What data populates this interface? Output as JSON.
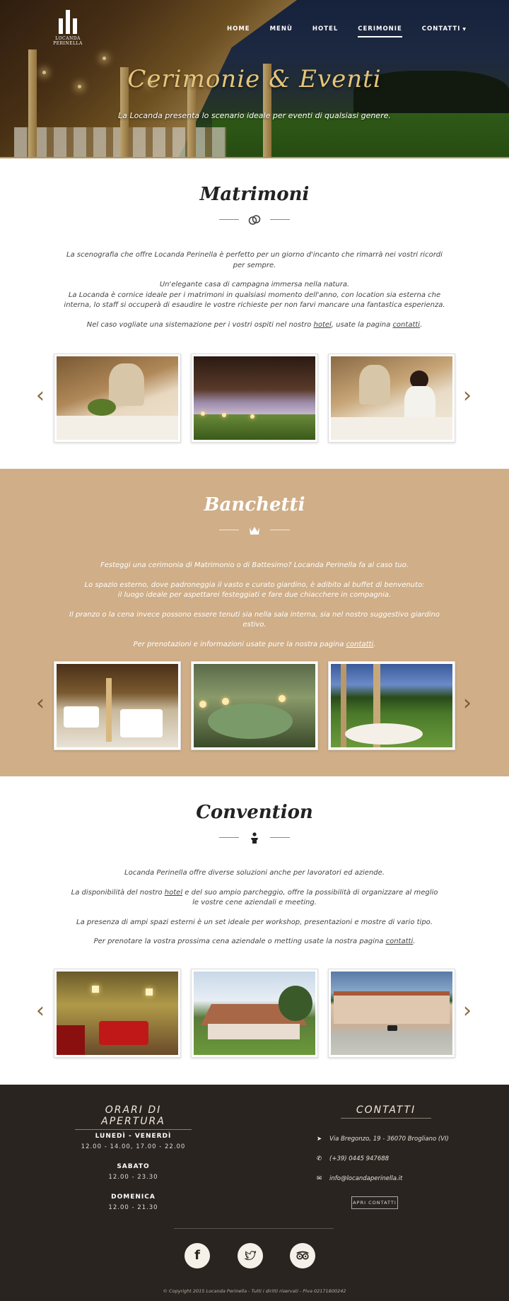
{
  "header": {
    "logo_text_1": "LOCANDA",
    "logo_text_2": "PERINELLA",
    "nav": [
      {
        "label": "HOME"
      },
      {
        "label": "MENÙ"
      },
      {
        "label": "HOTEL"
      },
      {
        "label": "CERIMONIE",
        "active": true
      },
      {
        "label": "CONTATTI"
      }
    ],
    "title": "Cerimonie & Eventi",
    "subtitle": "La Locanda presenta lo scenario ideale per eventi di qualsiasi genere."
  },
  "matrimoni": {
    "title": "Matrimoni",
    "icon": "rings-icon",
    "p1": "La scenografia che offre Locanda Perinella è perfetto per un giorno d'incanto che rimarrà nei vostri ricordi per sempre.",
    "p2a": "Un'elegante casa di campagna immersa nella natura.",
    "p2b": "La Locanda è cornice ideale per i matrimoni in qualsiasi momento dell'anno, con location sia esterna che interna, lo staff si occuperà di esaudire le vostre richieste per non farvi mancare una fantastica esperienza.",
    "p3_pre": "Nel caso vogliate una sistemazione per i vostri ospiti nel nostro ",
    "p3_link1": "hotel",
    "p3_mid": ", usate la pagina ",
    "p3_link2": "contatti",
    "p3_post": "."
  },
  "banchetti": {
    "title": "Banchetti",
    "icon": "crown-icon",
    "p1": "Festeggi una cerimonia di Matrimonio o di Battesimo? Locanda Perinella fa al caso tuo.",
    "p2a": "Lo spazio esterno, dove padroneggia il vasto e curato giardino, è adibito al buffet di benvenuto:",
    "p2b": "il luogo ideale per aspettarei festeggiati e fare due chiacchere in compagnia.",
    "p3": "Il pranzo o la cena invece possono essere tenuti sia nella sala interna, sia nel nostro suggestivo giardino estivo.",
    "p4_pre": "Per prenotazioni e informazioni usate pure la nostra pagina ",
    "p4_link": "contatti",
    "p4_post": "."
  },
  "convention": {
    "title": "Convention",
    "icon": "speaker-podium-icon",
    "p1": "Locanda Perinella offre diverse soluzioni anche per lavoratori ed aziende.",
    "p2_pre": "La disponibilità del nostro ",
    "p2_link": "hotel",
    "p2_post": " e del suo ampio parcheggio, offre la possibilità di organizzare al meglio",
    "p2b": "le vostre cene aziendali e meeting.",
    "p3": "La presenza di ampi spazi esterni è un set ideale per workshop, presentazioni e mostre di vario tipo.",
    "p4_pre": "Per prenotare la vostra prossima cena aziendale o metting usate la nostra pagina ",
    "p4_link": "contatti",
    "p4_post": "."
  },
  "footer": {
    "hours_title": "ORARI DI APERTURA",
    "hours": [
      {
        "day": "LUNEDÌ - VENERDÌ",
        "time": "12.00 - 14.00, 17.00 - 22.00"
      },
      {
        "day": "SABATO",
        "time": "12.00 - 23.30"
      },
      {
        "day": "DOMENICA",
        "time": "12.00 - 21.30"
      }
    ],
    "contacts_title": "CONTATTI",
    "address": "Via Bregonzo, 19 - 36070 Brogliano (VI)",
    "phone": "(+39) 0445 947688",
    "email": "info@locandaperinella.it",
    "contact_button": "APRI CONTATTI",
    "copyright": "© Copyright 2015 Locanda Perinella - Tutti i diritti riservati - Piva 02171800242"
  },
  "colors": {
    "accent_gold": "#e6c47a",
    "tan_section": "#cfae88",
    "footer_bg": "#2a2420",
    "arrow": "#8a6a3c"
  }
}
